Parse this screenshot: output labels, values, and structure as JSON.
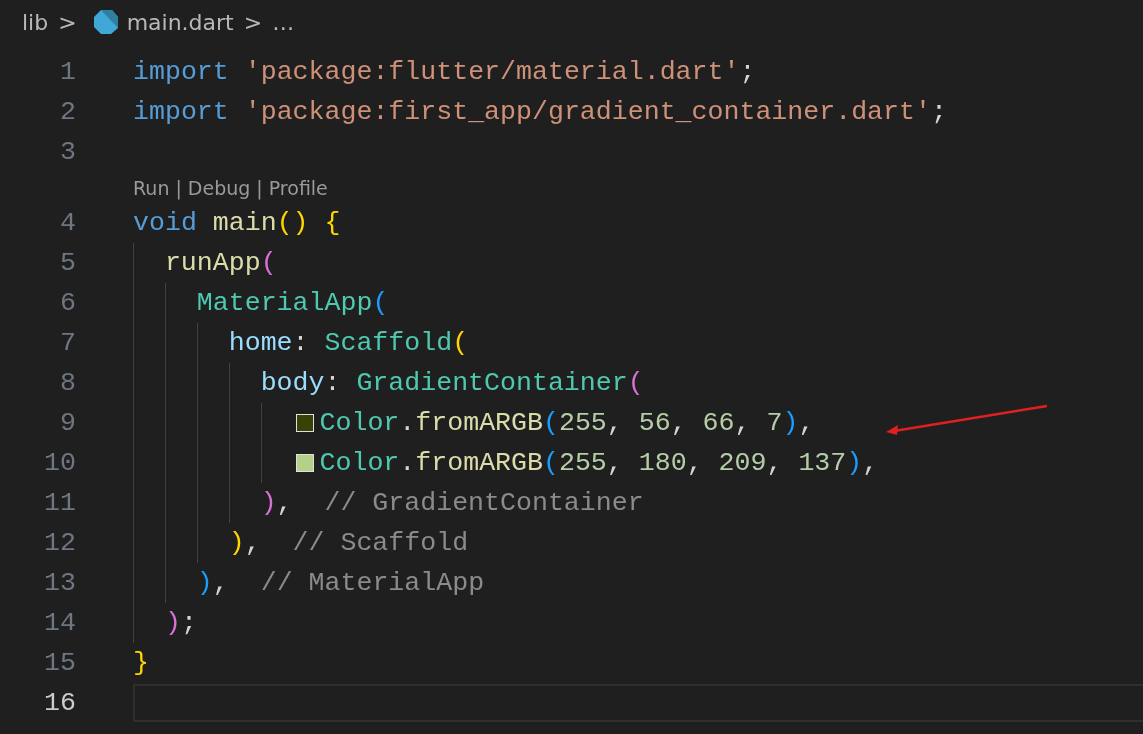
{
  "breadcrumb": {
    "items": [
      {
        "text": "lib",
        "kind": "folder"
      },
      {
        "text": "main.dart",
        "kind": "file"
      },
      {
        "text": "…",
        "kind": "more"
      }
    ],
    "separator": ">"
  },
  "lines": [
    {
      "kind": "code",
      "number": "1",
      "current": false,
      "tokens": [
        {
          "kind": "keyword",
          "text": "import"
        },
        {
          "kind": "string",
          "text": " 'package:flutter/material.dart'"
        },
        {
          "kind": "plain",
          "text": ";"
        }
      ]
    },
    {
      "kind": "code",
      "number": "2",
      "current": false,
      "tokens": [
        {
          "kind": "keyword",
          "text": "import"
        },
        {
          "kind": "string",
          "text": " 'package:first_app/gradient_container.dart'"
        },
        {
          "kind": "plain",
          "text": ";"
        }
      ]
    },
    {
      "kind": "code",
      "number": "3",
      "current": false
    },
    {
      "kind": "codelens",
      "links": [
        "Run",
        "Debug",
        "Profile"
      ],
      "separator": "|"
    },
    {
      "kind": "code",
      "number": "4",
      "current": false,
      "tokens": [
        {
          "kind": "keyword",
          "text": "void"
        },
        {
          "kind": "method",
          "text": " main"
        },
        {
          "kind": "bracket",
          "color": "#ffd700",
          "text": "()"
        },
        {
          "kind": "bracket",
          "color": "#ffd700",
          "text": " {"
        }
      ],
      "children": [
        {
          "kind": "code",
          "number": "5",
          "current": false,
          "tokens": [
            {
              "kind": "method",
              "text": "runApp"
            },
            {
              "kind": "bracket",
              "color": "#da70d6",
              "text": "("
            }
          ],
          "children": [
            {
              "kind": "code",
              "number": "6",
              "current": false,
              "tokens": [
                {
                  "kind": "type",
                  "text": "MaterialApp"
                },
                {
                  "kind": "bracket",
                  "color": "#179fff",
                  "text": "("
                }
              ],
              "children": [
                {
                  "kind": "code",
                  "number": "7",
                  "current": false,
                  "tokens": [
                    {
                      "kind": "property",
                      "text": "home"
                    },
                    {
                      "kind": "plain",
                      "text": ": "
                    },
                    {
                      "kind": "type",
                      "text": "Scaffold"
                    },
                    {
                      "kind": "bracket",
                      "color": "#ffd700",
                      "text": "("
                    }
                  ],
                  "children": [
                    {
                      "kind": "code",
                      "number": "8",
                      "current": false,
                      "tokens": [
                        {
                          "kind": "property",
                          "text": "body"
                        },
                        {
                          "kind": "plain",
                          "text": ": "
                        },
                        {
                          "kind": "type",
                          "text": "GradientContainer"
                        },
                        {
                          "kind": "bracket",
                          "color": "#da70d6",
                          "text": "("
                        }
                      ],
                      "children": [
                        {
                          "kind": "code",
                          "number": "9",
                          "current": false,
                          "swatch": {
                            "color": "#384207"
                          },
                          "tokens": [
                            {
                              "kind": "type",
                              "text": "Color"
                            },
                            {
                              "kind": "plain",
                              "text": "."
                            },
                            {
                              "kind": "method",
                              "text": "fromARGB"
                            },
                            {
                              "kind": "bracket",
                              "color": "#179fff",
                              "text": "("
                            },
                            {
                              "kind": "number",
                              "text": "255"
                            },
                            {
                              "kind": "plain",
                              "text": ", "
                            },
                            {
                              "kind": "number",
                              "text": "56"
                            },
                            {
                              "kind": "plain",
                              "text": ", "
                            },
                            {
                              "kind": "number",
                              "text": "66"
                            },
                            {
                              "kind": "plain",
                              "text": ", "
                            },
                            {
                              "kind": "number",
                              "text": "7"
                            },
                            {
                              "kind": "bracket",
                              "color": "#179fff",
                              "text": ")"
                            },
                            {
                              "kind": "plain",
                              "text": ","
                            }
                          ]
                        },
                        {
                          "kind": "code",
                          "number": "10",
                          "current": false,
                          "swatch": {
                            "color": "#b4d189"
                          },
                          "tokens": [
                            {
                              "kind": "type",
                              "text": "Color"
                            },
                            {
                              "kind": "plain",
                              "text": "."
                            },
                            {
                              "kind": "method",
                              "text": "fromARGB"
                            },
                            {
                              "kind": "bracket",
                              "color": "#179fff",
                              "text": "("
                            },
                            {
                              "kind": "number",
                              "text": "255"
                            },
                            {
                              "kind": "plain",
                              "text": ", "
                            },
                            {
                              "kind": "number",
                              "text": "180"
                            },
                            {
                              "kind": "plain",
                              "text": ", "
                            },
                            {
                              "kind": "number",
                              "text": "209"
                            },
                            {
                              "kind": "plain",
                              "text": ", "
                            },
                            {
                              "kind": "number",
                              "text": "137"
                            },
                            {
                              "kind": "bracket",
                              "color": "#179fff",
                              "text": ")"
                            },
                            {
                              "kind": "plain",
                              "text": ","
                            }
                          ]
                        }
                      ]
                    },
                    {
                      "kind": "code",
                      "number": "11",
                      "current": false,
                      "tokens": [
                        {
                          "kind": "bracket",
                          "color": "#da70d6",
                          "text": ")"
                        },
                        {
                          "kind": "plain",
                          "text": ",  "
                        },
                        {
                          "kind": "label",
                          "text": "// GradientContainer"
                        }
                      ]
                    }
                  ]
                },
                {
                  "kind": "code",
                  "number": "12",
                  "current": false,
                  "tokens": [
                    {
                      "kind": "bracket",
                      "color": "#ffd700",
                      "text": ")"
                    },
                    {
                      "kind": "plain",
                      "text": ",  "
                    },
                    {
                      "kind": "label",
                      "text": "// Scaffold"
                    }
                  ]
                }
              ]
            },
            {
              "kind": "code",
              "number": "13",
              "current": false,
              "tokens": [
                {
                  "kind": "bracket",
                  "color": "#179fff",
                  "text": ")"
                },
                {
                  "kind": "plain",
                  "text": ",  "
                },
                {
                  "kind": "label",
                  "text": "// MaterialApp"
                }
              ]
            }
          ]
        },
        {
          "kind": "code",
          "number": "14",
          "current": false,
          "tokens": [
            {
              "kind": "bracket",
              "color": "#da70d6",
              "text": ")"
            },
            {
              "kind": "plain",
              "text": ";"
            }
          ]
        }
      ]
    },
    {
      "kind": "code",
      "number": "15",
      "current": false,
      "tokens": [
        {
          "kind": "bracket",
          "color": "#ffd700",
          "text": "}"
        }
      ]
    },
    {
      "kind": "code",
      "number": "16",
      "current": true
    }
  ],
  "annotation": {
    "kind": "arrow",
    "color": "#e02020"
  }
}
